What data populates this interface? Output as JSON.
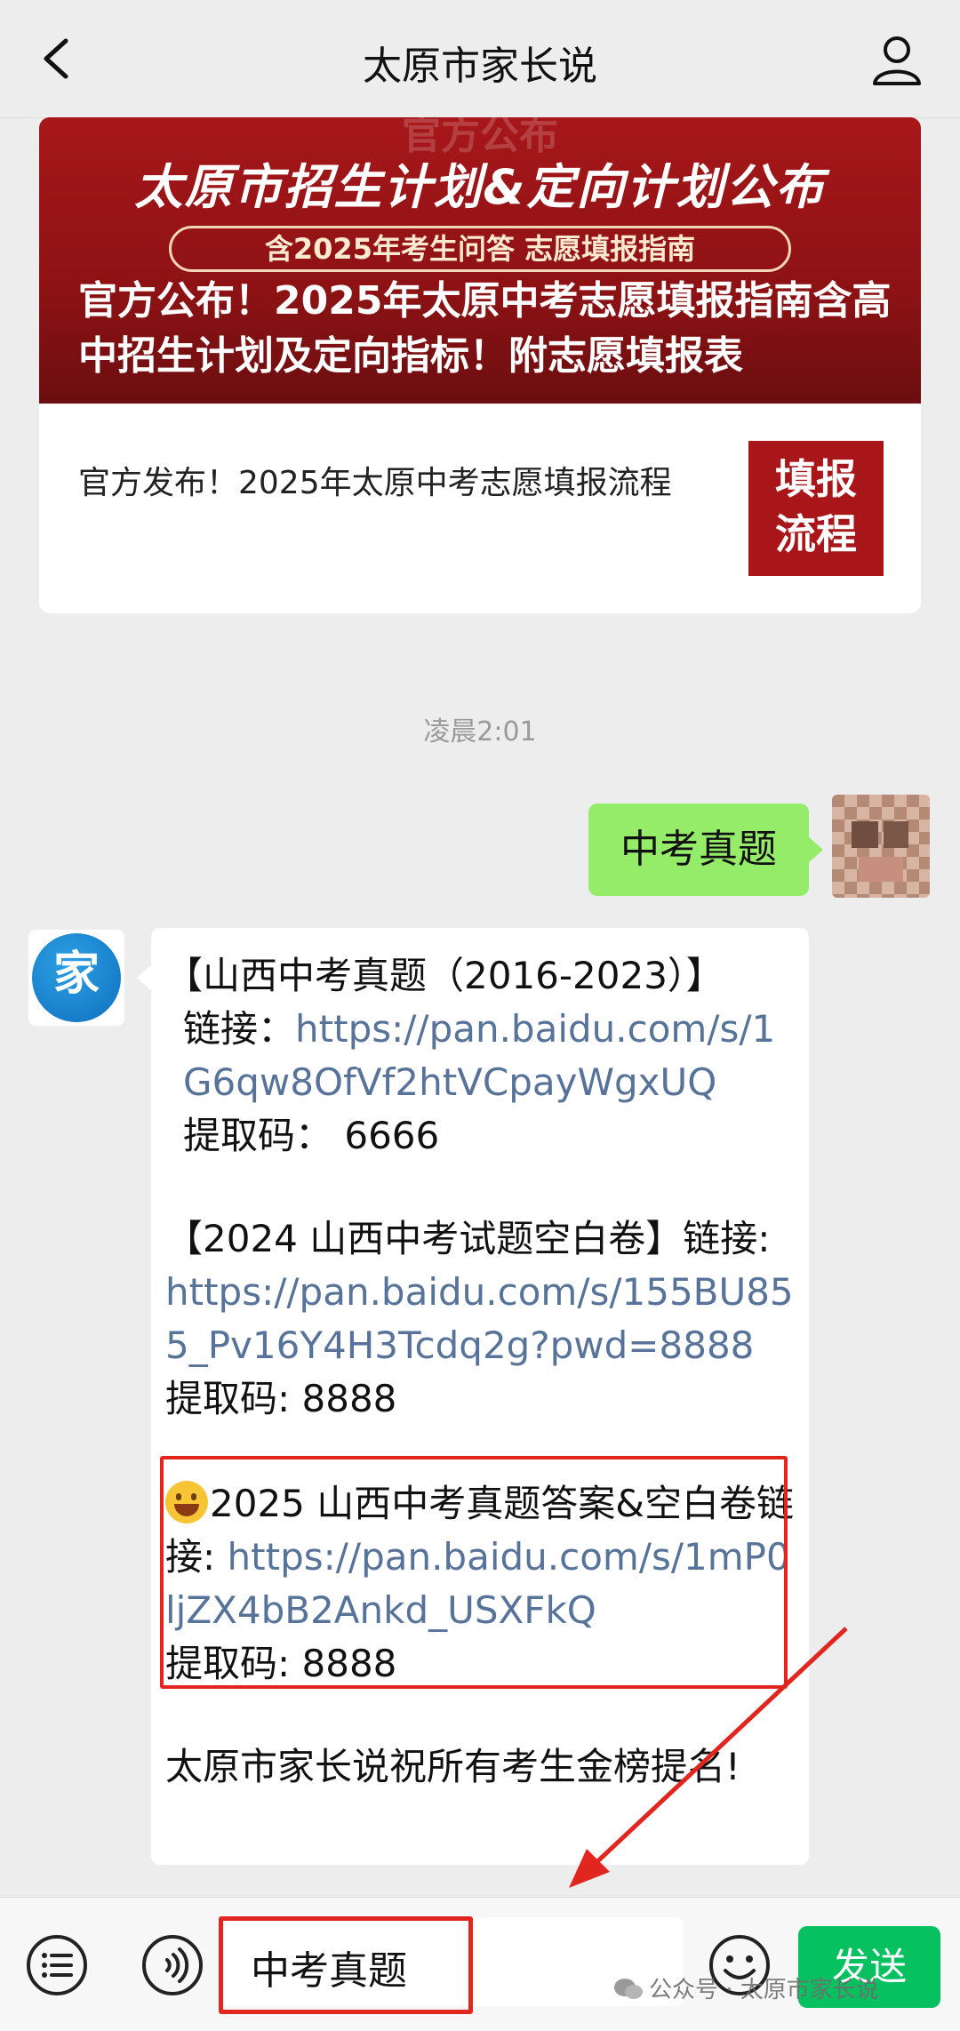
{
  "header": {
    "title": "太原市家长说"
  },
  "article": {
    "faint_top": "官方公布",
    "banner_headline": "太原市招生计划&定向计划公布",
    "banner_pill": "含2025年考生问答 志愿填报指南",
    "title": "官方公布！2025年太原中考志愿填报指南含高中招生计划及定向指标！附志愿填报表",
    "sub_title": "官方发布！2025年太原中考志愿填报流程",
    "thumb_line1": "填报",
    "thumb_line2": "流程"
  },
  "timestamp": "凌晨2:01",
  "outgoing_message": "中考真题",
  "reply": {
    "block1_head": "【山西中考真题（2016-2023）】",
    "block1_link_label": "链接：",
    "block1_link": "https://pan.baidu.com/s/1G6qw8OfVf2htVCpayWgxUQ",
    "block1_code": "提取码：  6666",
    "block2_head": "【2024 山西中考试题空白卷】链接: ",
    "block2_link": "https://pan.baidu.com/s/155BU855_Pv16Y4H3Tcdq2g?pwd=8888",
    "block2_code": " 提取码: 8888",
    "block3_head": "2025 山西中考真题答案&空白卷链接: ",
    "block3_link": "https://pan.baidu.com/s/1mP0ljZX4bB2Ankd_USXFkQ",
    "block3_code": "提取码: 8888",
    "closing": "太原市家长说祝所有考生金榜提名!"
  },
  "input_bar": {
    "value": "中考真题",
    "send_label": "发送"
  },
  "watermark": "公众号 · 太原市家长说",
  "colors": {
    "outgoing_bubble": "#95ec69",
    "link": "#57739a",
    "send_button": "#07c160",
    "highlight_box": "#e0261f"
  }
}
